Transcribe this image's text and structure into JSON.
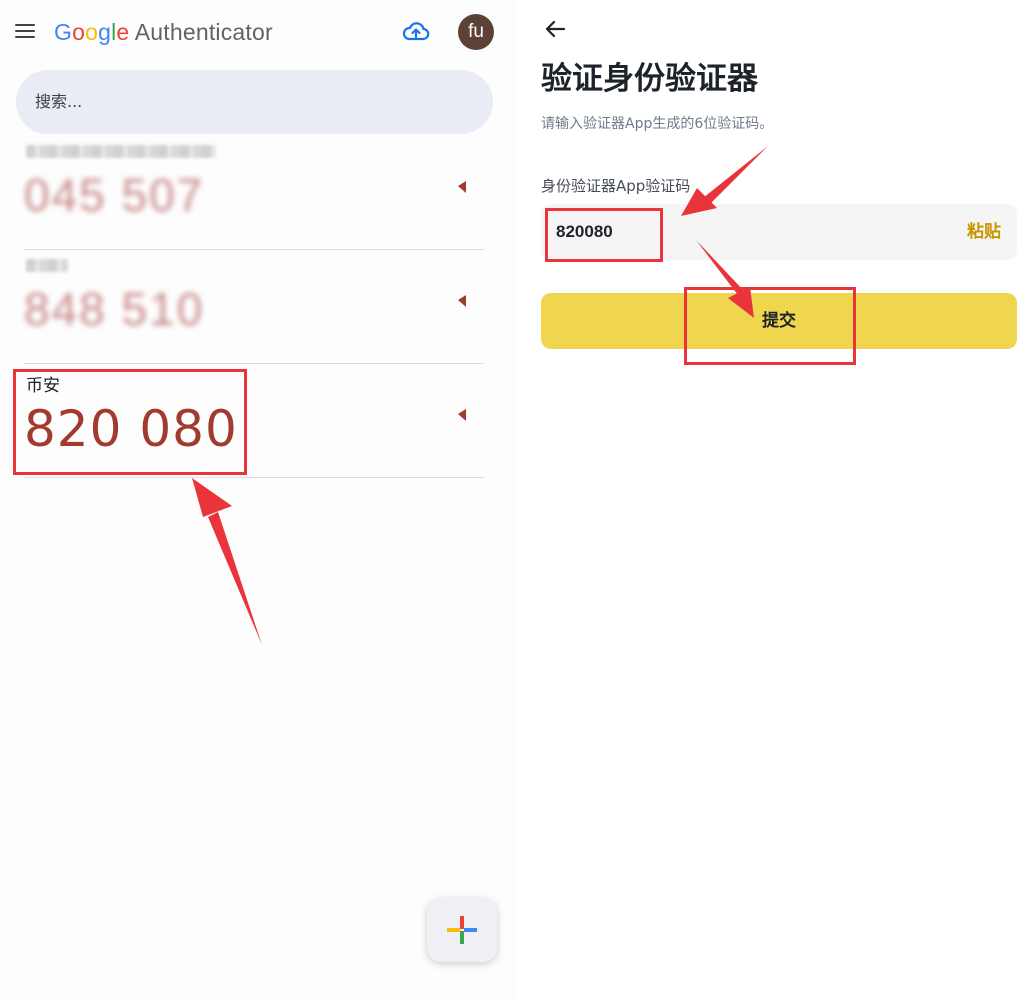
{
  "authenticator": {
    "brand_google": [
      "G",
      "o",
      "o",
      "g",
      "l",
      "e"
    ],
    "brand_app": "Authenticator",
    "avatar_initials": "fu",
    "search_placeholder": "搜索...",
    "entries": [
      {
        "name": "",
        "code": "045 507",
        "blurred": true
      },
      {
        "name": "",
        "code": "848 510",
        "blurred": true
      },
      {
        "name": "币安",
        "code": "820 080",
        "blurred": false
      }
    ],
    "icons": [
      "menu-icon",
      "cloud-upload-icon",
      "timer-icon",
      "plus-icon"
    ]
  },
  "verify_page": {
    "title": "验证身份验证器",
    "subtitle": "请输入验证器App生成的6位验证码。",
    "field_label": "身份验证器App验证码",
    "field_value": "820080",
    "paste_label": "粘贴",
    "submit_label": "提交",
    "icons": [
      "back-arrow-icon"
    ]
  },
  "colors": {
    "code_red": "#a33a2e",
    "annotation_red": "#e8343a",
    "submit_yellow": "#f0d54f",
    "paste_gold": "#c99400",
    "search_bg": "#e9ecf4"
  }
}
